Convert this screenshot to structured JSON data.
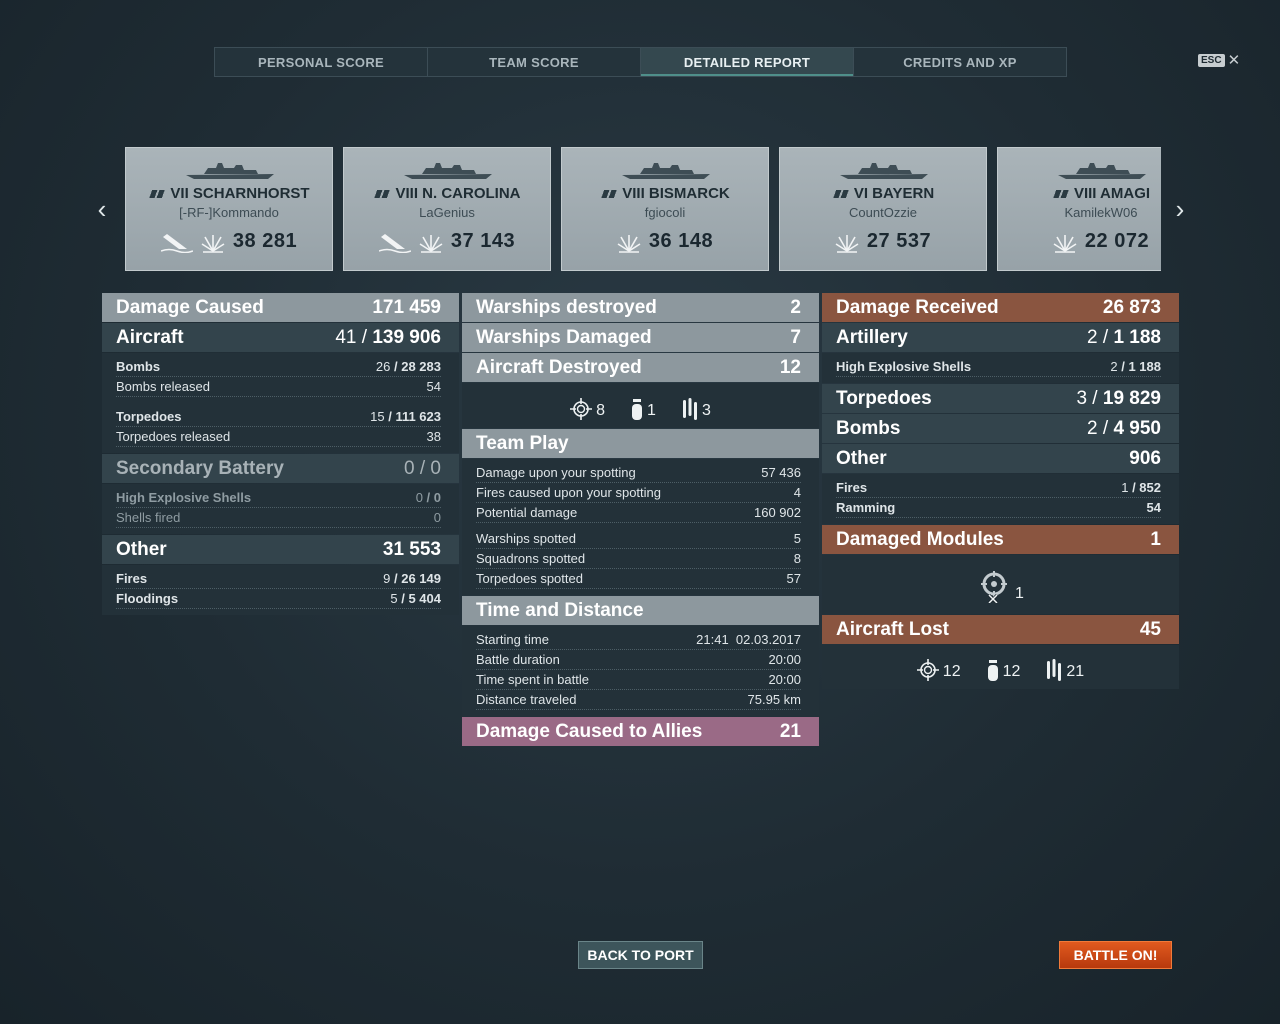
{
  "tabs": [
    {
      "label": "PERSONAL SCORE",
      "active": false
    },
    {
      "label": "TEAM SCORE",
      "active": false
    },
    {
      "label": "DETAILED REPORT",
      "active": true
    },
    {
      "label": "CREDITS AND XP",
      "active": false
    }
  ],
  "esc": {
    "key": "ESC",
    "close": "✕"
  },
  "nav": {
    "prev": "‹",
    "next": "›"
  },
  "ships": [
    {
      "name": "VII SCHARNHORST",
      "player": "[-RF-]Kommando",
      "score": "38 281",
      "sunk": true
    },
    {
      "name": "VIII N. CAROLINA",
      "player": "LaGenius",
      "score": "37 143",
      "sunk": true
    },
    {
      "name": "VIII BISMARCK",
      "player": "fgiocoli",
      "score": "36 148",
      "sunk": false
    },
    {
      "name": "VI BAYERN",
      "player": "CountOzzie",
      "score": "27 537",
      "sunk": false
    },
    {
      "name": "VIII AMAGI",
      "player": "KamilekW06",
      "score": "22 072",
      "sunk": false
    }
  ],
  "left": {
    "damage_caused": {
      "label": "Damage Caused",
      "value": "171 459"
    },
    "aircraft": {
      "label": "Aircraft",
      "hits": "41",
      "value": "139 906"
    },
    "bombs": {
      "label": "Bombs",
      "hits": "26",
      "value": "28 283"
    },
    "bombs_released": {
      "label": "Bombs released",
      "value": "54"
    },
    "torpedoes": {
      "label": "Torpedoes",
      "hits": "15",
      "value": "111 623"
    },
    "torpedoes_released": {
      "label": "Torpedoes released",
      "value": "38"
    },
    "secondary": {
      "label": "Secondary Battery",
      "hits": "0",
      "value": "0"
    },
    "he_shells": {
      "label": "High Explosive Shells",
      "hits": "0",
      "value": "0"
    },
    "shells_fired": {
      "label": "Shells fired",
      "value": "0"
    },
    "other": {
      "label": "Other",
      "value": "31 553"
    },
    "fires": {
      "label": "Fires",
      "hits": "9",
      "value": "26 149"
    },
    "floodings": {
      "label": "Floodings",
      "hits": "5",
      "value": "5 404"
    }
  },
  "middle": {
    "warships_destroyed": {
      "label": "Warships destroyed",
      "value": "2"
    },
    "warships_damaged": {
      "label": "Warships Damaged",
      "value": "7"
    },
    "aircraft_destroyed": {
      "label": "Aircraft Destroyed",
      "value": "12"
    },
    "aircraft_icons": {
      "fighters": "8",
      "bombers": "1",
      "torpedo": "3"
    },
    "team_play": {
      "label": "Team Play",
      "rows1": [
        {
          "label": "Damage upon your spotting",
          "value": "57 436"
        },
        {
          "label": "Fires caused upon your spotting",
          "value": "4"
        },
        {
          "label": "Potential damage",
          "value": "160 902"
        }
      ],
      "rows2": [
        {
          "label": "Warships spotted",
          "value": "5"
        },
        {
          "label": "Squadrons spotted",
          "value": "8"
        },
        {
          "label": "Torpedoes spotted",
          "value": "57"
        }
      ]
    },
    "time_distance": {
      "label": "Time and Distance",
      "rows": [
        {
          "label": "Starting time",
          "value": "21:41  02.03.2017"
        },
        {
          "label": "Battle duration",
          "value": "20:00"
        },
        {
          "label": "Time spent in battle",
          "value": "20:00"
        },
        {
          "label": "Distance traveled",
          "value": "75.95 km"
        }
      ]
    },
    "allies": {
      "label": "Damage Caused to Allies",
      "value": "21"
    }
  },
  "right": {
    "damage_received": {
      "label": "Damage Received",
      "value": "26 873"
    },
    "artillery": {
      "label": "Artillery",
      "hits": "2",
      "value": "1 188"
    },
    "he_shells": {
      "label": "High Explosive Shells",
      "hits": "2",
      "value": "1 188"
    },
    "torpedoes": {
      "label": "Torpedoes",
      "hits": "3",
      "value": "19 829"
    },
    "bombs": {
      "label": "Bombs",
      "hits": "2",
      "value": "4 950"
    },
    "other": {
      "label": "Other",
      "value": "906"
    },
    "fires": {
      "label": "Fires",
      "hits": "1",
      "value": "852"
    },
    "ramming": {
      "label": "Ramming",
      "value": "54"
    },
    "damaged_modules": {
      "label": "Damaged Modules",
      "value": "1"
    },
    "module_count": "1",
    "aircraft_lost": {
      "label": "Aircraft Lost",
      "value": "45"
    },
    "aircraft_icons": {
      "fighters": "12",
      "bombers": "12",
      "torpedo": "21"
    }
  },
  "buttons": {
    "port": "BACK TO PORT",
    "battle": "BATTLE ON!"
  },
  "colors": {
    "gray_header": "#8d989e",
    "received": "#8a5540",
    "allies": "#9a6a86",
    "battle_button": "#d14a15"
  }
}
